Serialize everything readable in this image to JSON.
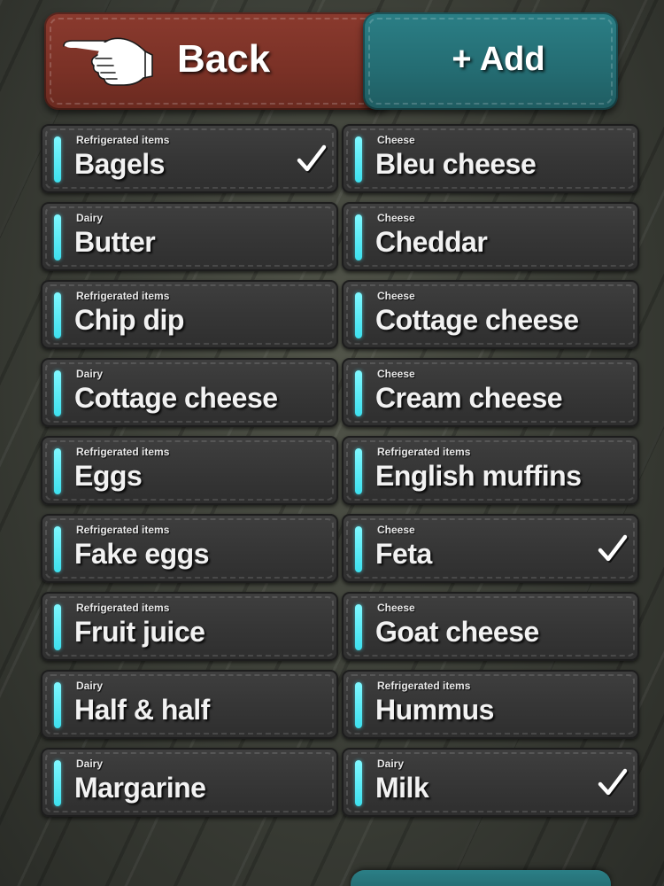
{
  "header": {
    "back_label": "Back",
    "add_label": "+ Add"
  },
  "items": [
    {
      "category": "Refrigerated items",
      "name": "Bagels",
      "checked": true
    },
    {
      "category": "Cheese",
      "name": "Bleu cheese",
      "checked": false
    },
    {
      "category": "Dairy",
      "name": "Butter",
      "checked": false
    },
    {
      "category": "Cheese",
      "name": "Cheddar",
      "checked": false
    },
    {
      "category": "Refrigerated items",
      "name": "Chip dip",
      "checked": false
    },
    {
      "category": "Cheese",
      "name": "Cottage cheese",
      "checked": false
    },
    {
      "category": "Dairy",
      "name": "Cottage cheese",
      "checked": false
    },
    {
      "category": "Cheese",
      "name": "Cream cheese",
      "checked": false
    },
    {
      "category": "Refrigerated items",
      "name": "Eggs",
      "checked": false
    },
    {
      "category": "Refrigerated items",
      "name": "English muffins",
      "checked": false
    },
    {
      "category": "Refrigerated items",
      "name": "Fake eggs",
      "checked": false
    },
    {
      "category": "Cheese",
      "name": "Feta",
      "checked": true
    },
    {
      "category": "Refrigerated items",
      "name": "Fruit juice",
      "checked": false
    },
    {
      "category": "Cheese",
      "name": "Goat cheese",
      "checked": false
    },
    {
      "category": "Dairy",
      "name": "Half & half",
      "checked": false
    },
    {
      "category": "Refrigerated items",
      "name": "Hummus",
      "checked": false
    },
    {
      "category": "Dairy",
      "name": "Margarine",
      "checked": false
    },
    {
      "category": "Dairy",
      "name": "Milk",
      "checked": true
    }
  ],
  "colors": {
    "back_button": "#7a3126",
    "add_button": "#246c72",
    "item_background": "#363636",
    "accent_bar": "#3de0ee",
    "text": "#f2f2f2"
  },
  "icons": {
    "back": "pointing-hand-icon",
    "checked": "checkmark-icon"
  }
}
